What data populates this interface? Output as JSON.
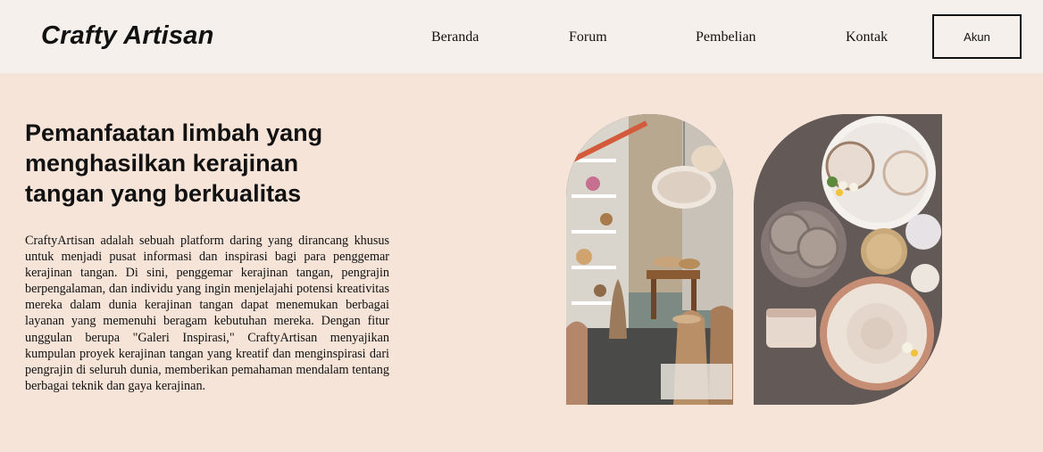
{
  "header": {
    "logo": "Crafty Artisan",
    "nav": [
      "Beranda",
      "Forum",
      "Pembelian",
      "Kontak"
    ],
    "account_button": "Akun"
  },
  "hero": {
    "title": "Pemanfaatan limbah yang menghasilkan kerajinan tangan yang berkualitas",
    "description": "CraftyArtisan adalah sebuah platform daring yang dirancang khusus untuk menjadi pusat informasi dan inspirasi bagi para penggemar kerajinan tangan. Di sini, penggemar kerajinan tangan, pengrajin berpengalaman, dan individu yang ingin menjelajahi potensi kreativitas mereka dalam dunia kerajinan tangan dapat menemukan berbagai layanan yang memenuhi beragam kebutuhan mereka. Dengan fitur unggulan berupa \"Galeri Inspirasi,\" CraftyArtisan menyajikan kumpulan proyek kerajinan tangan yang kreatif dan menginspirasi dari pengrajin di seluruh dunia, memberikan pemahaman mendalam tentang berbagai teknik dan gaya kerajinan."
  },
  "colors": {
    "page_background": "#f6e4d8",
    "header_background": "#f6f0ec",
    "text": "#111111"
  }
}
